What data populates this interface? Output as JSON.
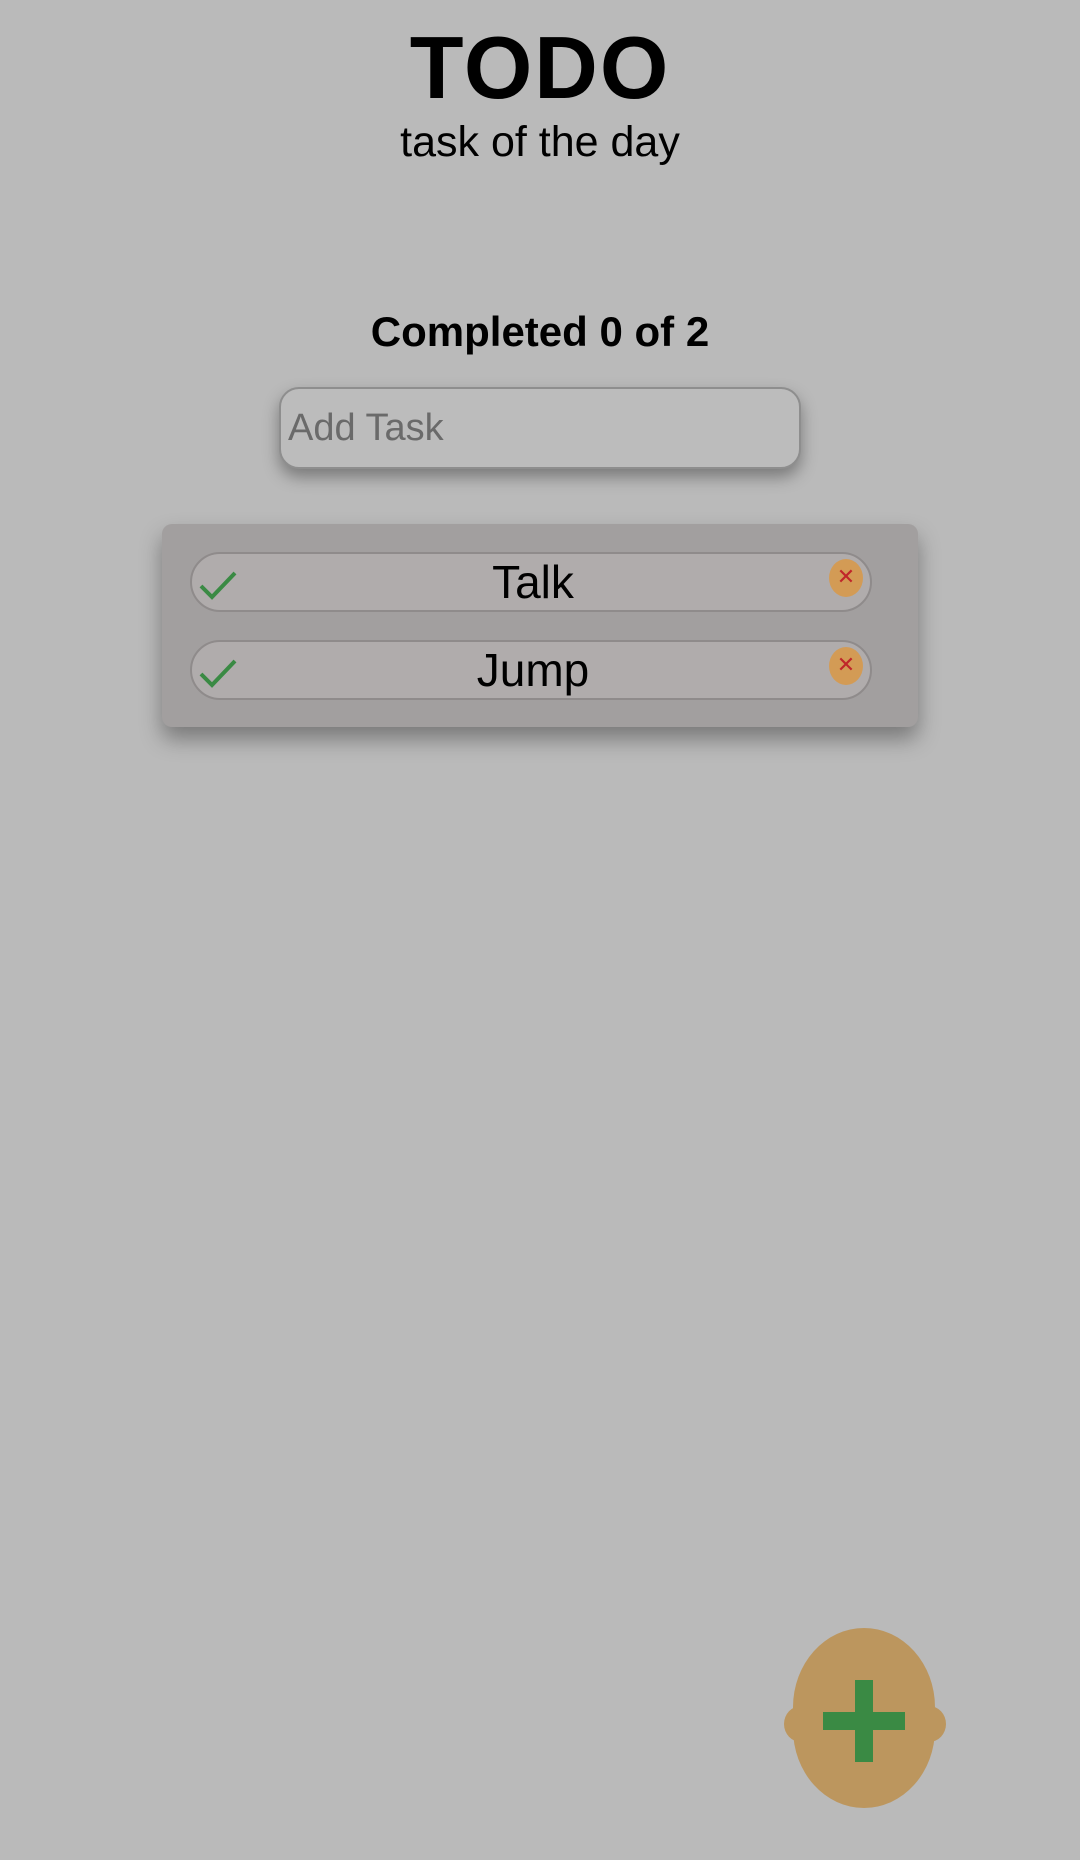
{
  "header": {
    "title": "TODO",
    "subtitle": "task of the day"
  },
  "progress": {
    "text": "Completed 0 of 2",
    "completed": 0,
    "total": 2
  },
  "add_task": {
    "placeholder": "Add Task",
    "value": ""
  },
  "tasks": [
    {
      "label": "Talk",
      "completed": false
    },
    {
      "label": "Jump",
      "completed": false
    }
  ],
  "icons": {
    "check": "check-icon",
    "delete": "close-icon",
    "fab": "plus-icon"
  },
  "colors": {
    "background": "#bababa",
    "panel": "#a29f9f",
    "check": "#3a8a44",
    "delete_bg": "#d39b55",
    "delete_x": "#c0262a",
    "fab": "#bc965e",
    "fab_plus": "#3a8a44"
  }
}
